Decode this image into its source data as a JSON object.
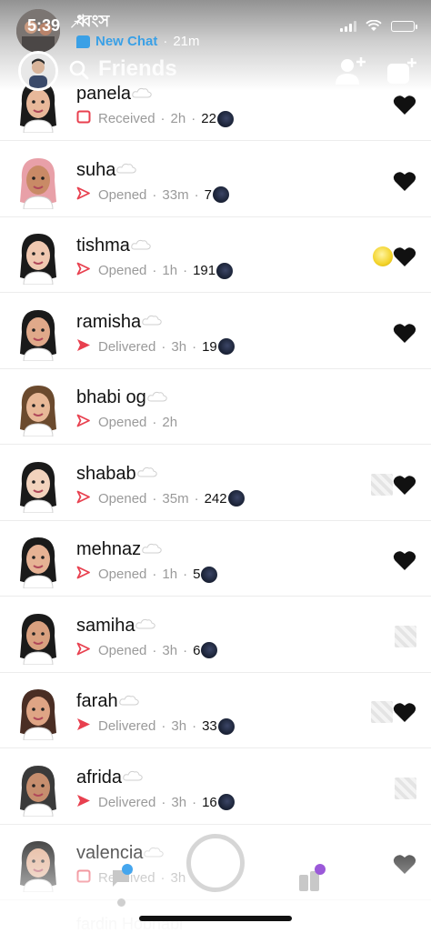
{
  "status_bar": {
    "time": "5:39",
    "location_arrow": "↗"
  },
  "top_chat": {
    "name": "ধ্বংস",
    "status_label": "New Chat",
    "separator": "·",
    "time": "21m",
    "status_color": "#3aa0e6"
  },
  "header": {
    "title": "Friends",
    "icons": [
      "search-icon",
      "add-friend-icon",
      "new-chat-icon"
    ]
  },
  "colors": {
    "unopened_snap_red": "#e8404f",
    "chat_blue": "#3aa0e6",
    "secondary_text": "#9a9a9a"
  },
  "friends": [
    {
      "name": "panela",
      "status": "Received",
      "status_icon": "received-square-icon",
      "time": "2h",
      "streak": "22",
      "badge": "black-heart"
    },
    {
      "name": "suha",
      "status": "Opened",
      "status_icon": "opened-arrow-icon",
      "time": "33m",
      "streak": "7",
      "badge": "black-heart"
    },
    {
      "name": "tishma",
      "status": "Opened",
      "status_icon": "opened-arrow-icon",
      "time": "1h",
      "streak": "191",
      "badge": "sun-and-black-heart"
    },
    {
      "name": "ramisha",
      "status": "Delivered",
      "status_icon": "delivered-arrow-icon",
      "time": "3h",
      "streak": "19",
      "badge": "black-heart"
    },
    {
      "name": "bhabi og",
      "status": "Opened",
      "status_icon": "opened-arrow-icon",
      "time": "2h",
      "streak": "",
      "badge": "none"
    },
    {
      "name": "shabab",
      "status": "Opened",
      "status_icon": "opened-arrow-icon",
      "time": "35m",
      "streak": "242",
      "badge": "blurred-and-black-heart"
    },
    {
      "name": "mehnaz",
      "status": "Opened",
      "status_icon": "opened-arrow-icon",
      "time": "1h",
      "streak": "5",
      "badge": "black-heart"
    },
    {
      "name": "samiha",
      "status": "Opened",
      "status_icon": "opened-arrow-icon",
      "time": "3h",
      "streak": "6",
      "badge": "blurred"
    },
    {
      "name": "farah",
      "status": "Delivered",
      "status_icon": "delivered-arrow-icon",
      "time": "3h",
      "streak": "33",
      "badge": "blurred-and-black-heart"
    },
    {
      "name": "afrida",
      "status": "Delivered",
      "status_icon": "delivered-arrow-icon",
      "time": "3h",
      "streak": "16",
      "badge": "blurred"
    },
    {
      "name": "valencia",
      "status": "Received",
      "status_icon": "received-square-icon",
      "time": "3h",
      "streak": "",
      "badge": "black-heart"
    }
  ],
  "peek_next_name": "fardin Hobhabi",
  "bottom_nav": {
    "items": [
      "chat-icon",
      "capture-button",
      "discover-icon"
    ],
    "chat_dot_color": "#45a6ee",
    "discover_dot_color": "#9b59d9"
  }
}
